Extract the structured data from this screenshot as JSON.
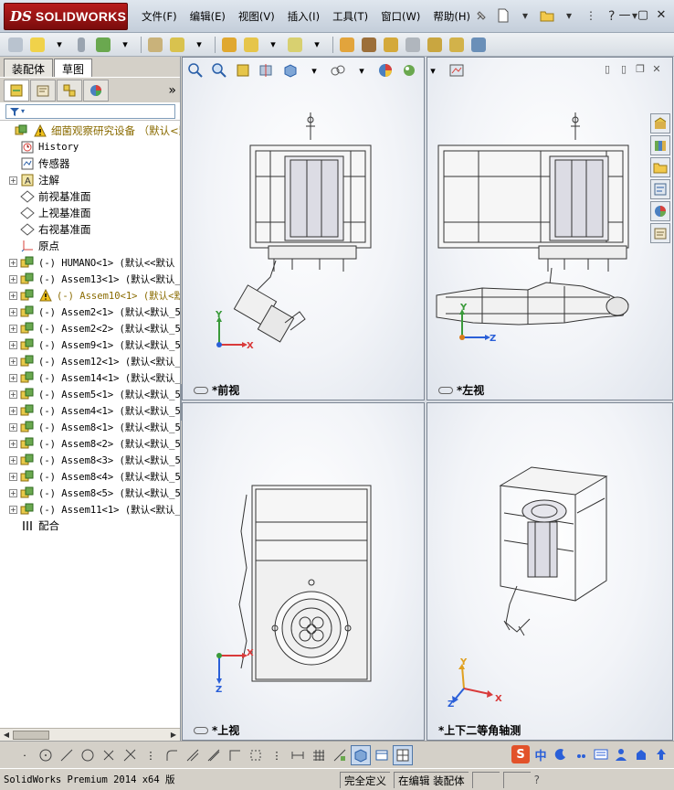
{
  "app": {
    "logo_prefix": "DS",
    "logo_text": "SOLIDWORKS",
    "menu": [
      "文件(F)",
      "编辑(E)",
      "视图(V)",
      "插入(I)",
      "工具(T)",
      "窗口(W)",
      "帮助(H)"
    ],
    "window_controls": [
      "—",
      "▢",
      "✕"
    ]
  },
  "left_panel": {
    "tabs": [
      "装配体",
      "草图"
    ],
    "active_tab": "装配体",
    "feature_tabs": [
      "featuremanager-icon",
      "propertymanager-icon",
      "configurationmanager-icon",
      "displaymanager-icon"
    ],
    "more": "»",
    "filter_icon": "filter-icon",
    "tree": [
      {
        "label": "细菌观察研究设备 （默认<默认",
        "expand": false,
        "icon": "assembly-warning-icon",
        "indent": 0,
        "warn": true,
        "cjk": true
      },
      {
        "label": "History",
        "expand": false,
        "icon": "history-icon",
        "indent": 1
      },
      {
        "label": "传感器",
        "expand": false,
        "icon": "sensor-icon",
        "indent": 1,
        "cjk": true
      },
      {
        "label": "注解",
        "expand": true,
        "icon": "annotation-icon",
        "indent": 1,
        "cjk": true
      },
      {
        "label": "前视基准面",
        "expand": false,
        "icon": "plane-icon",
        "indent": 1,
        "cjk": true
      },
      {
        "label": "上视基准面",
        "expand": false,
        "icon": "plane-icon",
        "indent": 1,
        "cjk": true
      },
      {
        "label": "右视基准面",
        "expand": false,
        "icon": "plane-icon",
        "indent": 1,
        "cjk": true
      },
      {
        "label": "原点",
        "expand": false,
        "icon": "origin-icon",
        "indent": 1,
        "cjk": true
      },
      {
        "label": "(-) HUMANO<1> (默认<<默认",
        "expand": true,
        "icon": "subassembly-icon",
        "indent": 1
      },
      {
        "label": "(-) Assem13<1> (默认<默认_",
        "expand": true,
        "icon": "subassembly-icon",
        "indent": 1
      },
      {
        "label": "(-) Assem10<1> (默认<默认",
        "expand": true,
        "icon": "subassembly-warning-icon",
        "indent": 1,
        "warn": true
      },
      {
        "label": "(-) Assem2<1> (默认<默认_5",
        "expand": true,
        "icon": "subassembly-icon",
        "indent": 1
      },
      {
        "label": "(-) Assem2<2> (默认<默认_5",
        "expand": true,
        "icon": "subassembly-icon",
        "indent": 1
      },
      {
        "label": "(-) Assem9<1> (默认<默认_5",
        "expand": true,
        "icon": "subassembly-icon",
        "indent": 1
      },
      {
        "label": "(-) Assem12<1> (默认<默认_",
        "expand": true,
        "icon": "subassembly-icon",
        "indent": 1
      },
      {
        "label": "(-) Assem14<1> (默认<默认_",
        "expand": true,
        "icon": "subassembly-icon",
        "indent": 1
      },
      {
        "label": "(-) Assem5<1> (默认<默认_5",
        "expand": true,
        "icon": "subassembly-icon",
        "indent": 1
      },
      {
        "label": "(-) Assem4<1> (默认<默认_5",
        "expand": true,
        "icon": "subassembly-icon",
        "indent": 1
      },
      {
        "label": "(-) Assem8<1> (默认<默认_5",
        "expand": true,
        "icon": "subassembly-icon",
        "indent": 1
      },
      {
        "label": "(-) Assem8<2> (默认<默认_5",
        "expand": true,
        "icon": "subassembly-icon",
        "indent": 1
      },
      {
        "label": "(-) Assem8<3> (默认<默认_5",
        "expand": true,
        "icon": "subassembly-icon",
        "indent": 1
      },
      {
        "label": "(-) Assem8<4> (默认<默认_5",
        "expand": true,
        "icon": "subassembly-icon",
        "indent": 1
      },
      {
        "label": "(-) Assem8<5> (默认<默认_5",
        "expand": true,
        "icon": "subassembly-icon",
        "indent": 1
      },
      {
        "label": "(-) Assem11<1> (默认<默认_",
        "expand": true,
        "icon": "subassembly-icon",
        "indent": 1
      },
      {
        "label": "配合",
        "expand": false,
        "icon": "mates-icon",
        "indent": 1,
        "cjk": true
      }
    ]
  },
  "viewports": [
    {
      "id": "front",
      "label": "*前视"
    },
    {
      "id": "left",
      "label": "*左视"
    },
    {
      "id": "top",
      "label": "*上视"
    },
    {
      "id": "iso",
      "label": "*上下二等角轴测"
    }
  ],
  "axes": {
    "x": "X",
    "y": "Y",
    "z": "Z"
  },
  "status": {
    "product": "SolidWorks Premium 2014 x64 版",
    "definition": "完全定义",
    "editing": "在编辑 装配体"
  },
  "ime": {
    "brand": "S",
    "lang": "中"
  },
  "colors": {
    "accent": "#2a5fa8",
    "warning": "#e0b400",
    "logo": "#b81c1c"
  }
}
